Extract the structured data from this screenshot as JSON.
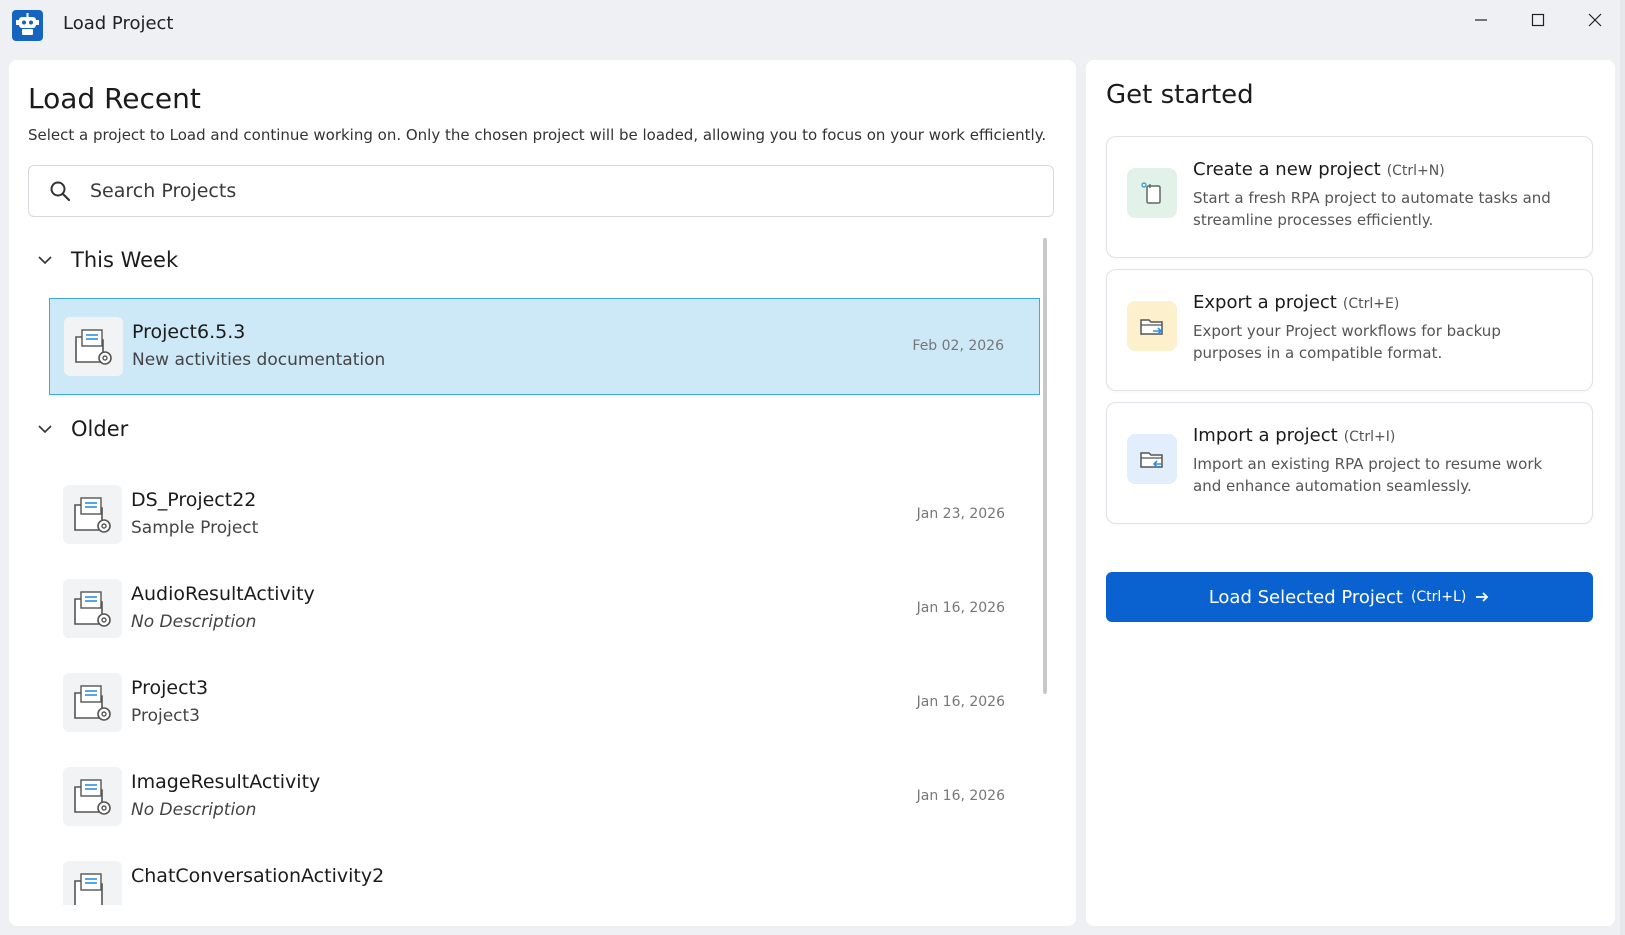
{
  "window": {
    "title": "Load Project"
  },
  "left": {
    "heading": "Load Recent",
    "subtitle": "Select a project to Load and continue working on. Only the chosen project will be loaded, allowing you to focus on your work efficiently.",
    "search": {
      "placeholder": "Search Projects",
      "value": ""
    },
    "groups": [
      {
        "label": "This Week",
        "items": [
          {
            "name": "Project6.5.3",
            "description": "New activities documentation",
            "date": "Feb 02, 2026",
            "selected": true
          }
        ]
      },
      {
        "label": "Older",
        "items": [
          {
            "name": "DS_Project22",
            "description": "Sample Project",
            "date": "Jan 23, 2026"
          },
          {
            "name": "AudioResultActivity",
            "description": "No Description",
            "date": "Jan 16, 2026"
          },
          {
            "name": "Project3",
            "description": "Project3",
            "date": "Jan 16, 2026"
          },
          {
            "name": "ImageResultActivity",
            "description": "No Description",
            "date": "Jan 16, 2026"
          },
          {
            "name": "ChatConversationActivity2",
            "description": "",
            "date": ""
          }
        ]
      }
    ]
  },
  "right": {
    "heading": "Get started",
    "cards": [
      {
        "title": "Create a new project",
        "shortcut": "(Ctrl+N)",
        "description": "Start a fresh RPA project to automate tasks and streamline processes efficiently.",
        "icon": "new-project-icon",
        "icon_bg": "#e3f2e8"
      },
      {
        "title": "Export a project",
        "shortcut": "(Ctrl+E)",
        "description": "Export your Project workflows for backup purposes in a compatible format.",
        "icon": "export-folder-icon",
        "icon_bg": "#fdf0cc"
      },
      {
        "title": "Import a project",
        "shortcut": "(Ctrl+I)",
        "description": "Import an existing RPA project to resume work and enhance automation seamlessly.",
        "icon": "import-folder-icon",
        "icon_bg": "#e2eefb"
      }
    ],
    "load_button": {
      "label": "Load Selected Project",
      "shortcut": "(Ctrl+L)"
    }
  },
  "colors": {
    "accent": "#0a62d1",
    "selected_row_bg": "#cde8f6",
    "selected_row_border": "#3ba7e4"
  }
}
